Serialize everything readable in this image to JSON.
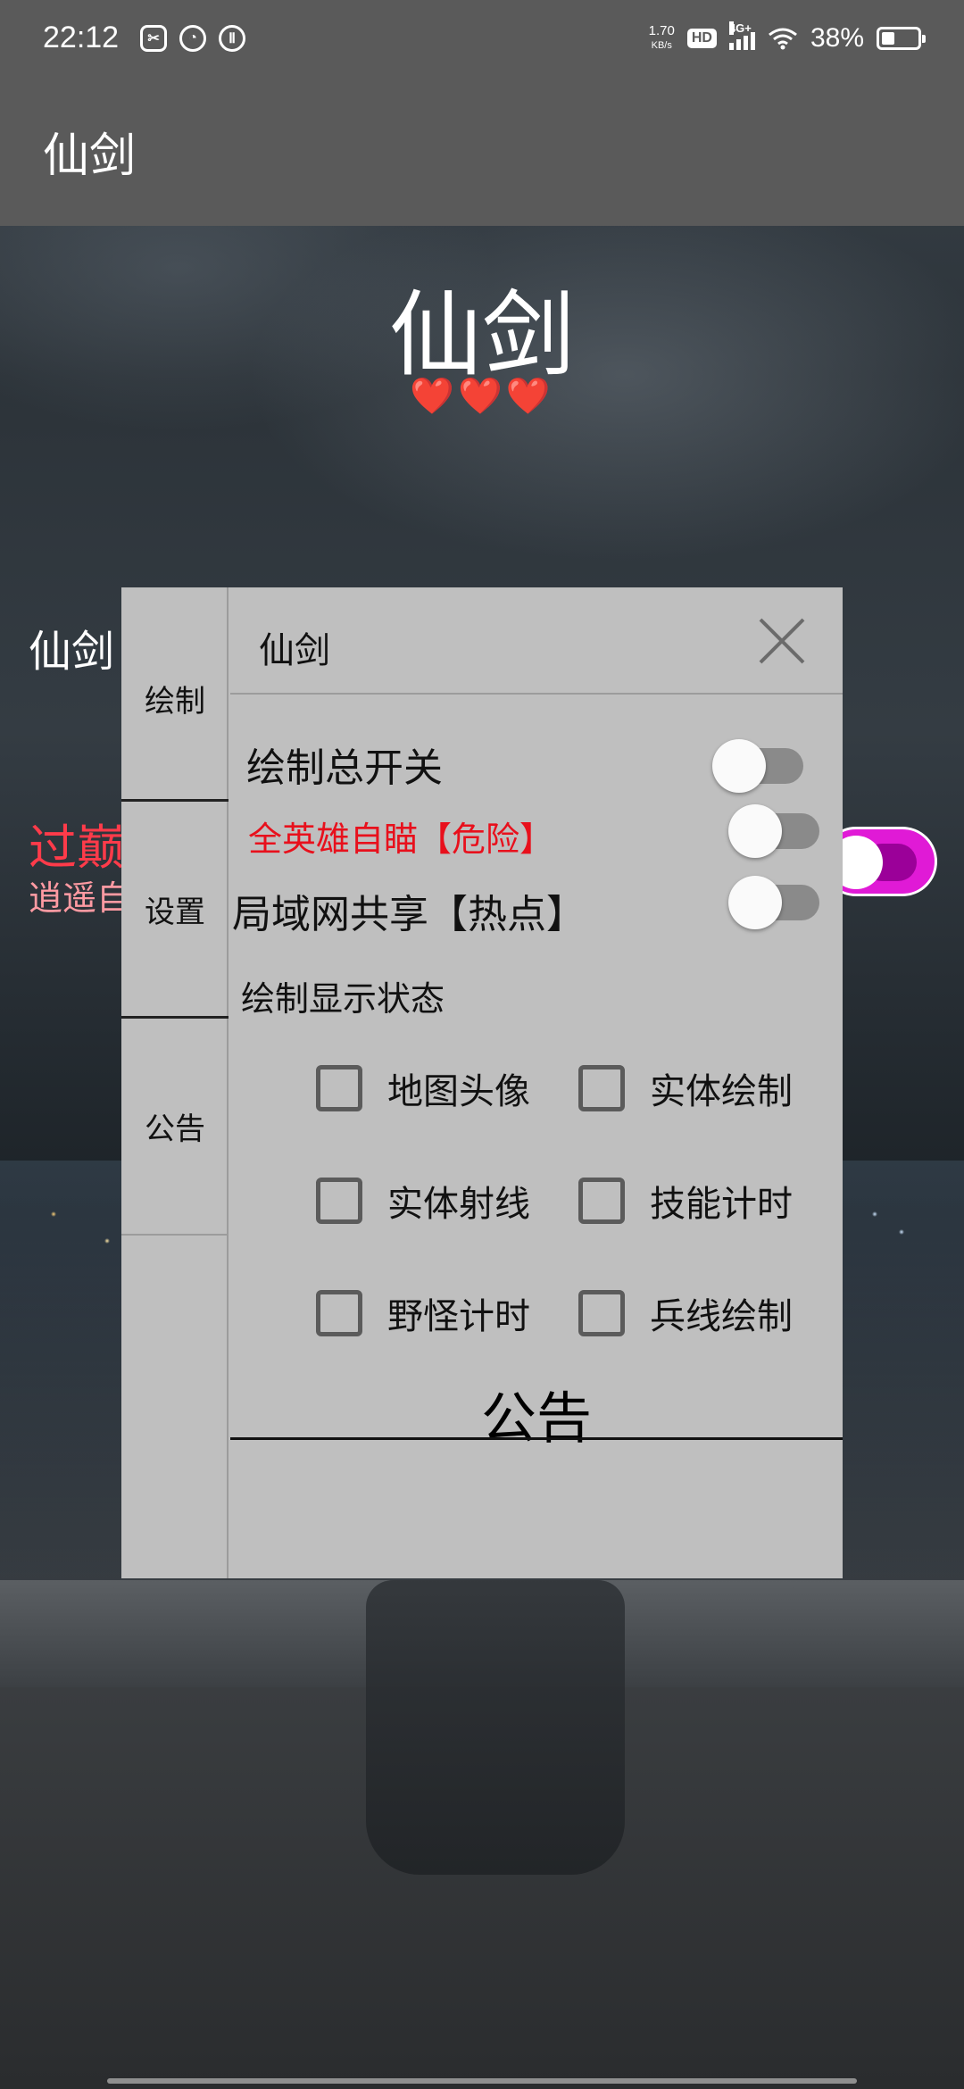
{
  "status_bar": {
    "time": "22:12",
    "net_speed_value": "1.70",
    "net_speed_unit": "KB/s",
    "hd_badge": "HD",
    "network_type": "4G+",
    "battery_percent": "38%",
    "battery_level": 0.38
  },
  "app_bar": {
    "title": "仙剑"
  },
  "hero": {
    "title": "仙剑",
    "hearts": "❤️❤️❤️"
  },
  "background_texts": {
    "label": "仙剑",
    "red_title": "过巅",
    "red_sub": "逍遥自"
  },
  "dialog": {
    "title": "仙剑",
    "tabs": [
      {
        "label": "绘制"
      },
      {
        "label": "设置"
      },
      {
        "label": "公告"
      }
    ],
    "switches": [
      {
        "label": "绘制总开关",
        "on": false
      },
      {
        "label": "全英雄自瞄【危险】",
        "on": false
      },
      {
        "label": "局域网共享【热点】",
        "on": false
      }
    ],
    "section_label": "绘制显示状态",
    "checkboxes": [
      {
        "label": "地图头像",
        "checked": false
      },
      {
        "label": "实体绘制",
        "checked": false
      },
      {
        "label": "实体射线",
        "checked": false
      },
      {
        "label": "技能计时",
        "checked": false
      },
      {
        "label": "野怪计时",
        "checked": false
      },
      {
        "label": "兵线绘制",
        "checked": false
      }
    ],
    "notice_heading": "公告"
  },
  "colors": {
    "app_bar": "#5a5a5a",
    "dialog_bg": "#bfbfbf",
    "danger_text": "#e8101c",
    "hearts": "#e21b23",
    "toggle_accent": "#e01ad6"
  }
}
